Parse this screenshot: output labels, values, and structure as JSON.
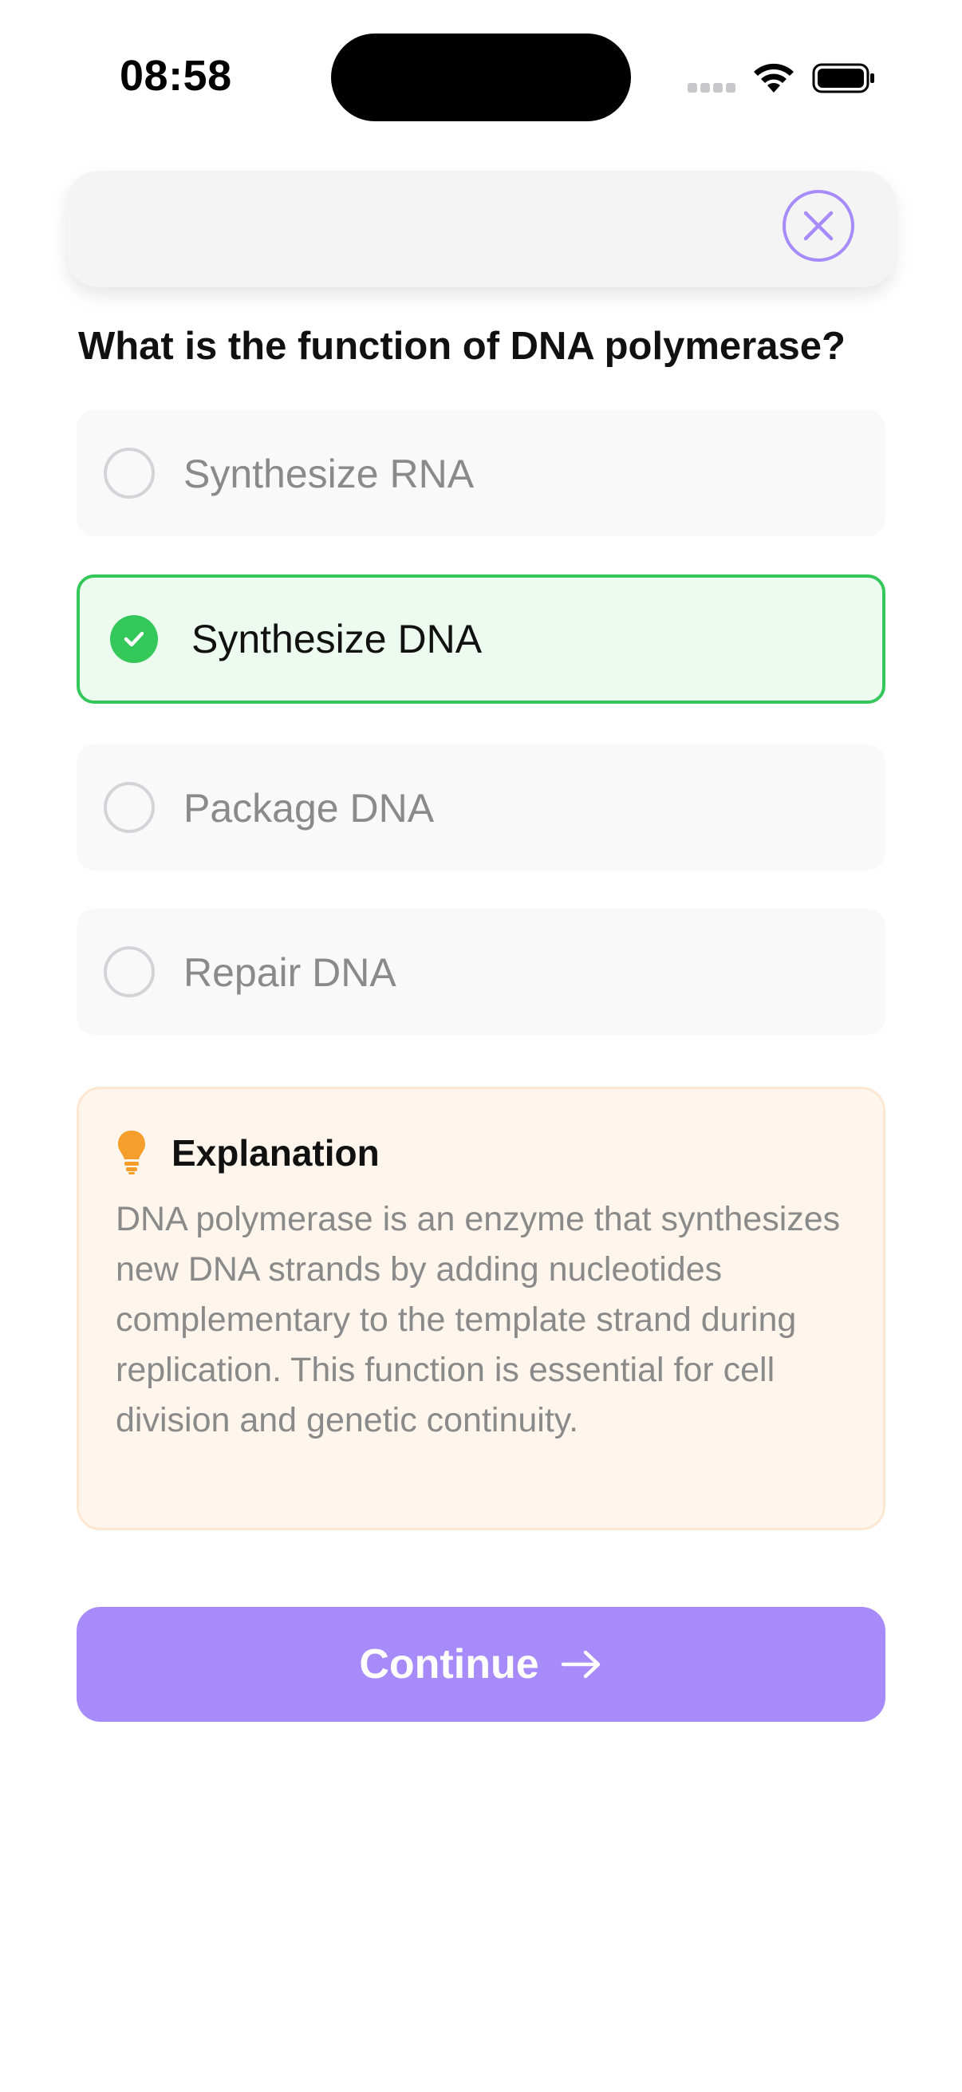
{
  "status_bar": {
    "time": "08:58"
  },
  "header": {
    "close_icon": "close-icon"
  },
  "question": {
    "text": "What is the function of DNA polymerase?"
  },
  "options": [
    {
      "label": "Synthesize RNA",
      "state": "unselected"
    },
    {
      "label": "Synthesize DNA",
      "state": "correct"
    },
    {
      "label": "Package DNA",
      "state": "unselected"
    },
    {
      "label": "Repair DNA",
      "state": "unselected"
    }
  ],
  "explanation": {
    "icon": "lightbulb-icon",
    "title": "Explanation",
    "body": "DNA polymerase is an enzyme that synthesizes new DNA strands by adding nucleotides complementary to the template strand during replication. This function is essential for cell division and genetic continuity."
  },
  "continue_button": {
    "label": "Continue",
    "icon": "arrow-right-icon"
  },
  "colors": {
    "accent": "#a78bfa",
    "correct": "#34c759",
    "correct_bg": "#ecfaef",
    "explanation_bg": "#fef5ec",
    "explanation_icon": "#f59e2b"
  }
}
